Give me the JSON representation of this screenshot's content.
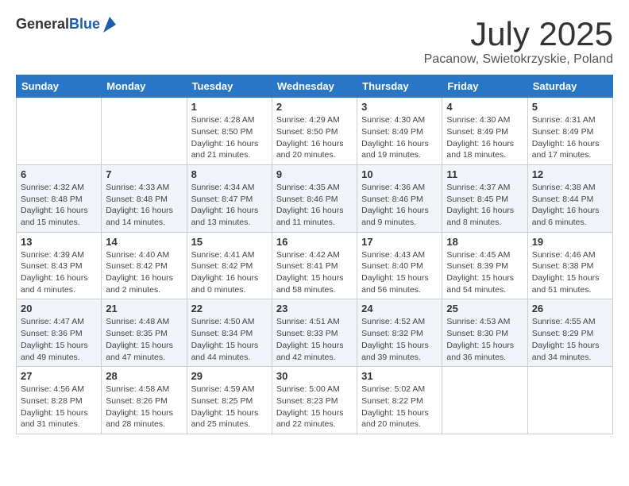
{
  "logo": {
    "general": "General",
    "blue": "Blue"
  },
  "header": {
    "title": "July 2025",
    "subtitle": "Pacanow, Swietokrzyskie, Poland"
  },
  "weekdays": [
    "Sunday",
    "Monday",
    "Tuesday",
    "Wednesday",
    "Thursday",
    "Friday",
    "Saturday"
  ],
  "weeks": [
    [
      {
        "day": "",
        "sunrise": "",
        "sunset": "",
        "daylight": ""
      },
      {
        "day": "",
        "sunrise": "",
        "sunset": "",
        "daylight": ""
      },
      {
        "day": "1",
        "sunrise": "Sunrise: 4:28 AM",
        "sunset": "Sunset: 8:50 PM",
        "daylight": "Daylight: 16 hours and 21 minutes."
      },
      {
        "day": "2",
        "sunrise": "Sunrise: 4:29 AM",
        "sunset": "Sunset: 8:50 PM",
        "daylight": "Daylight: 16 hours and 20 minutes."
      },
      {
        "day": "3",
        "sunrise": "Sunrise: 4:30 AM",
        "sunset": "Sunset: 8:49 PM",
        "daylight": "Daylight: 16 hours and 19 minutes."
      },
      {
        "day": "4",
        "sunrise": "Sunrise: 4:30 AM",
        "sunset": "Sunset: 8:49 PM",
        "daylight": "Daylight: 16 hours and 18 minutes."
      },
      {
        "day": "5",
        "sunrise": "Sunrise: 4:31 AM",
        "sunset": "Sunset: 8:49 PM",
        "daylight": "Daylight: 16 hours and 17 minutes."
      }
    ],
    [
      {
        "day": "6",
        "sunrise": "Sunrise: 4:32 AM",
        "sunset": "Sunset: 8:48 PM",
        "daylight": "Daylight: 16 hours and 15 minutes."
      },
      {
        "day": "7",
        "sunrise": "Sunrise: 4:33 AM",
        "sunset": "Sunset: 8:48 PM",
        "daylight": "Daylight: 16 hours and 14 minutes."
      },
      {
        "day": "8",
        "sunrise": "Sunrise: 4:34 AM",
        "sunset": "Sunset: 8:47 PM",
        "daylight": "Daylight: 16 hours and 13 minutes."
      },
      {
        "day": "9",
        "sunrise": "Sunrise: 4:35 AM",
        "sunset": "Sunset: 8:46 PM",
        "daylight": "Daylight: 16 hours and 11 minutes."
      },
      {
        "day": "10",
        "sunrise": "Sunrise: 4:36 AM",
        "sunset": "Sunset: 8:46 PM",
        "daylight": "Daylight: 16 hours and 9 minutes."
      },
      {
        "day": "11",
        "sunrise": "Sunrise: 4:37 AM",
        "sunset": "Sunset: 8:45 PM",
        "daylight": "Daylight: 16 hours and 8 minutes."
      },
      {
        "day": "12",
        "sunrise": "Sunrise: 4:38 AM",
        "sunset": "Sunset: 8:44 PM",
        "daylight": "Daylight: 16 hours and 6 minutes."
      }
    ],
    [
      {
        "day": "13",
        "sunrise": "Sunrise: 4:39 AM",
        "sunset": "Sunset: 8:43 PM",
        "daylight": "Daylight: 16 hours and 4 minutes."
      },
      {
        "day": "14",
        "sunrise": "Sunrise: 4:40 AM",
        "sunset": "Sunset: 8:42 PM",
        "daylight": "Daylight: 16 hours and 2 minutes."
      },
      {
        "day": "15",
        "sunrise": "Sunrise: 4:41 AM",
        "sunset": "Sunset: 8:42 PM",
        "daylight": "Daylight: 16 hours and 0 minutes."
      },
      {
        "day": "16",
        "sunrise": "Sunrise: 4:42 AM",
        "sunset": "Sunset: 8:41 PM",
        "daylight": "Daylight: 15 hours and 58 minutes."
      },
      {
        "day": "17",
        "sunrise": "Sunrise: 4:43 AM",
        "sunset": "Sunset: 8:40 PM",
        "daylight": "Daylight: 15 hours and 56 minutes."
      },
      {
        "day": "18",
        "sunrise": "Sunrise: 4:45 AM",
        "sunset": "Sunset: 8:39 PM",
        "daylight": "Daylight: 15 hours and 54 minutes."
      },
      {
        "day": "19",
        "sunrise": "Sunrise: 4:46 AM",
        "sunset": "Sunset: 8:38 PM",
        "daylight": "Daylight: 15 hours and 51 minutes."
      }
    ],
    [
      {
        "day": "20",
        "sunrise": "Sunrise: 4:47 AM",
        "sunset": "Sunset: 8:36 PM",
        "daylight": "Daylight: 15 hours and 49 minutes."
      },
      {
        "day": "21",
        "sunrise": "Sunrise: 4:48 AM",
        "sunset": "Sunset: 8:35 PM",
        "daylight": "Daylight: 15 hours and 47 minutes."
      },
      {
        "day": "22",
        "sunrise": "Sunrise: 4:50 AM",
        "sunset": "Sunset: 8:34 PM",
        "daylight": "Daylight: 15 hours and 44 minutes."
      },
      {
        "day": "23",
        "sunrise": "Sunrise: 4:51 AM",
        "sunset": "Sunset: 8:33 PM",
        "daylight": "Daylight: 15 hours and 42 minutes."
      },
      {
        "day": "24",
        "sunrise": "Sunrise: 4:52 AM",
        "sunset": "Sunset: 8:32 PM",
        "daylight": "Daylight: 15 hours and 39 minutes."
      },
      {
        "day": "25",
        "sunrise": "Sunrise: 4:53 AM",
        "sunset": "Sunset: 8:30 PM",
        "daylight": "Daylight: 15 hours and 36 minutes."
      },
      {
        "day": "26",
        "sunrise": "Sunrise: 4:55 AM",
        "sunset": "Sunset: 8:29 PM",
        "daylight": "Daylight: 15 hours and 34 minutes."
      }
    ],
    [
      {
        "day": "27",
        "sunrise": "Sunrise: 4:56 AM",
        "sunset": "Sunset: 8:28 PM",
        "daylight": "Daylight: 15 hours and 31 minutes."
      },
      {
        "day": "28",
        "sunrise": "Sunrise: 4:58 AM",
        "sunset": "Sunset: 8:26 PM",
        "daylight": "Daylight: 15 hours and 28 minutes."
      },
      {
        "day": "29",
        "sunrise": "Sunrise: 4:59 AM",
        "sunset": "Sunset: 8:25 PM",
        "daylight": "Daylight: 15 hours and 25 minutes."
      },
      {
        "day": "30",
        "sunrise": "Sunrise: 5:00 AM",
        "sunset": "Sunset: 8:23 PM",
        "daylight": "Daylight: 15 hours and 22 minutes."
      },
      {
        "day": "31",
        "sunrise": "Sunrise: 5:02 AM",
        "sunset": "Sunset: 8:22 PM",
        "daylight": "Daylight: 15 hours and 20 minutes."
      },
      {
        "day": "",
        "sunrise": "",
        "sunset": "",
        "daylight": ""
      },
      {
        "day": "",
        "sunrise": "",
        "sunset": "",
        "daylight": ""
      }
    ]
  ]
}
